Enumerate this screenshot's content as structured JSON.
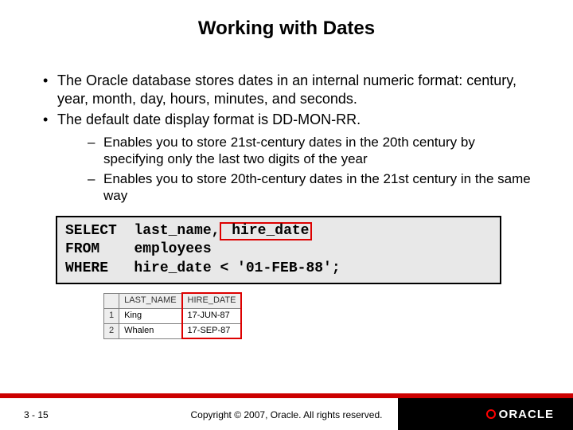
{
  "title": "Working with Dates",
  "bullets": {
    "b1": "The Oracle database stores dates in an internal numeric format: century, year, month, day, hours, minutes, and seconds.",
    "b2": "The default date display format is DD-MON-RR.",
    "s1": "Enables you to store 21st-century dates in the 20th century by specifying only the last two digits of the year",
    "s2": "Enables you to store 20th-century dates in the 21st century in the same way"
  },
  "code": {
    "kw_select": "SELECT",
    "select_cols": "last_name,",
    "select_hl": " hire_date",
    "kw_from": "FROM",
    "from_tbl": "employees",
    "kw_where": "WHERE",
    "where_expr": "hire_date < '01-FEB-88';"
  },
  "result_table": {
    "headers": {
      "sel": "",
      "c1": "LAST_NAME",
      "c2": "HIRE_DATE"
    },
    "rows": [
      {
        "n": "1",
        "c1": "King",
        "c2": "17-JUN-87"
      },
      {
        "n": "2",
        "c1": "Whalen",
        "c2": "17-SEP-87"
      }
    ]
  },
  "footer": {
    "page": "3 - 15",
    "copyright": "Copyright © 2007, Oracle. All rights reserved.",
    "logo": "ORACLE"
  }
}
